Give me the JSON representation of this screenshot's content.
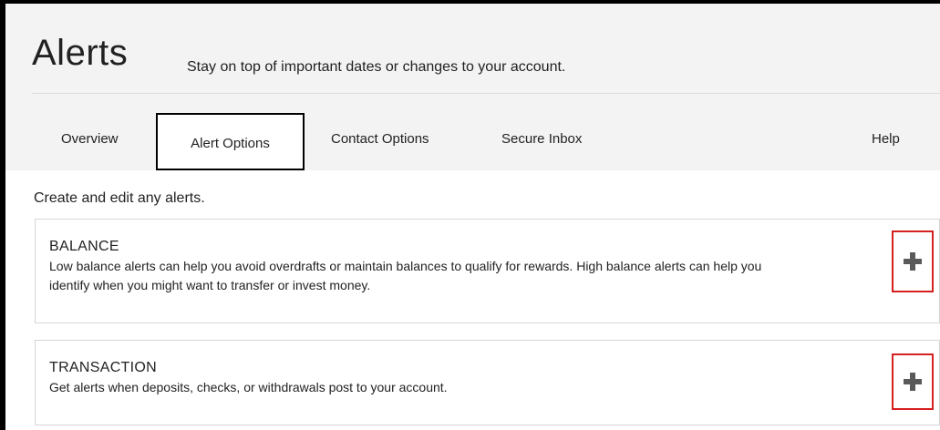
{
  "header": {
    "title": "Alerts",
    "subtitle": "Stay on top of important dates or changes to your account."
  },
  "tabs": {
    "overview": "Overview",
    "alert_options": "Alert Options",
    "contact_options": "Contact Options",
    "secure_inbox": "Secure Inbox",
    "help": "Help",
    "active": "Alert Options"
  },
  "main": {
    "intro": "Create and edit any alerts.",
    "cards": [
      {
        "title": "BALANCE",
        "description": "Low balance alerts can help you avoid overdrafts or maintain balances to qualify for rewards. High balance alerts can help you identify when you might want to transfer or invest money.",
        "action_icon": "plus-icon"
      },
      {
        "title": "TRANSACTION",
        "description": "Get alerts when deposits, checks, or withdrawals post to your account.",
        "action_icon": "plus-icon"
      }
    ]
  },
  "colors": {
    "header_bg": "#f3f3f3",
    "highlight_border": "#d62020",
    "icon": "#5a5a5a"
  }
}
